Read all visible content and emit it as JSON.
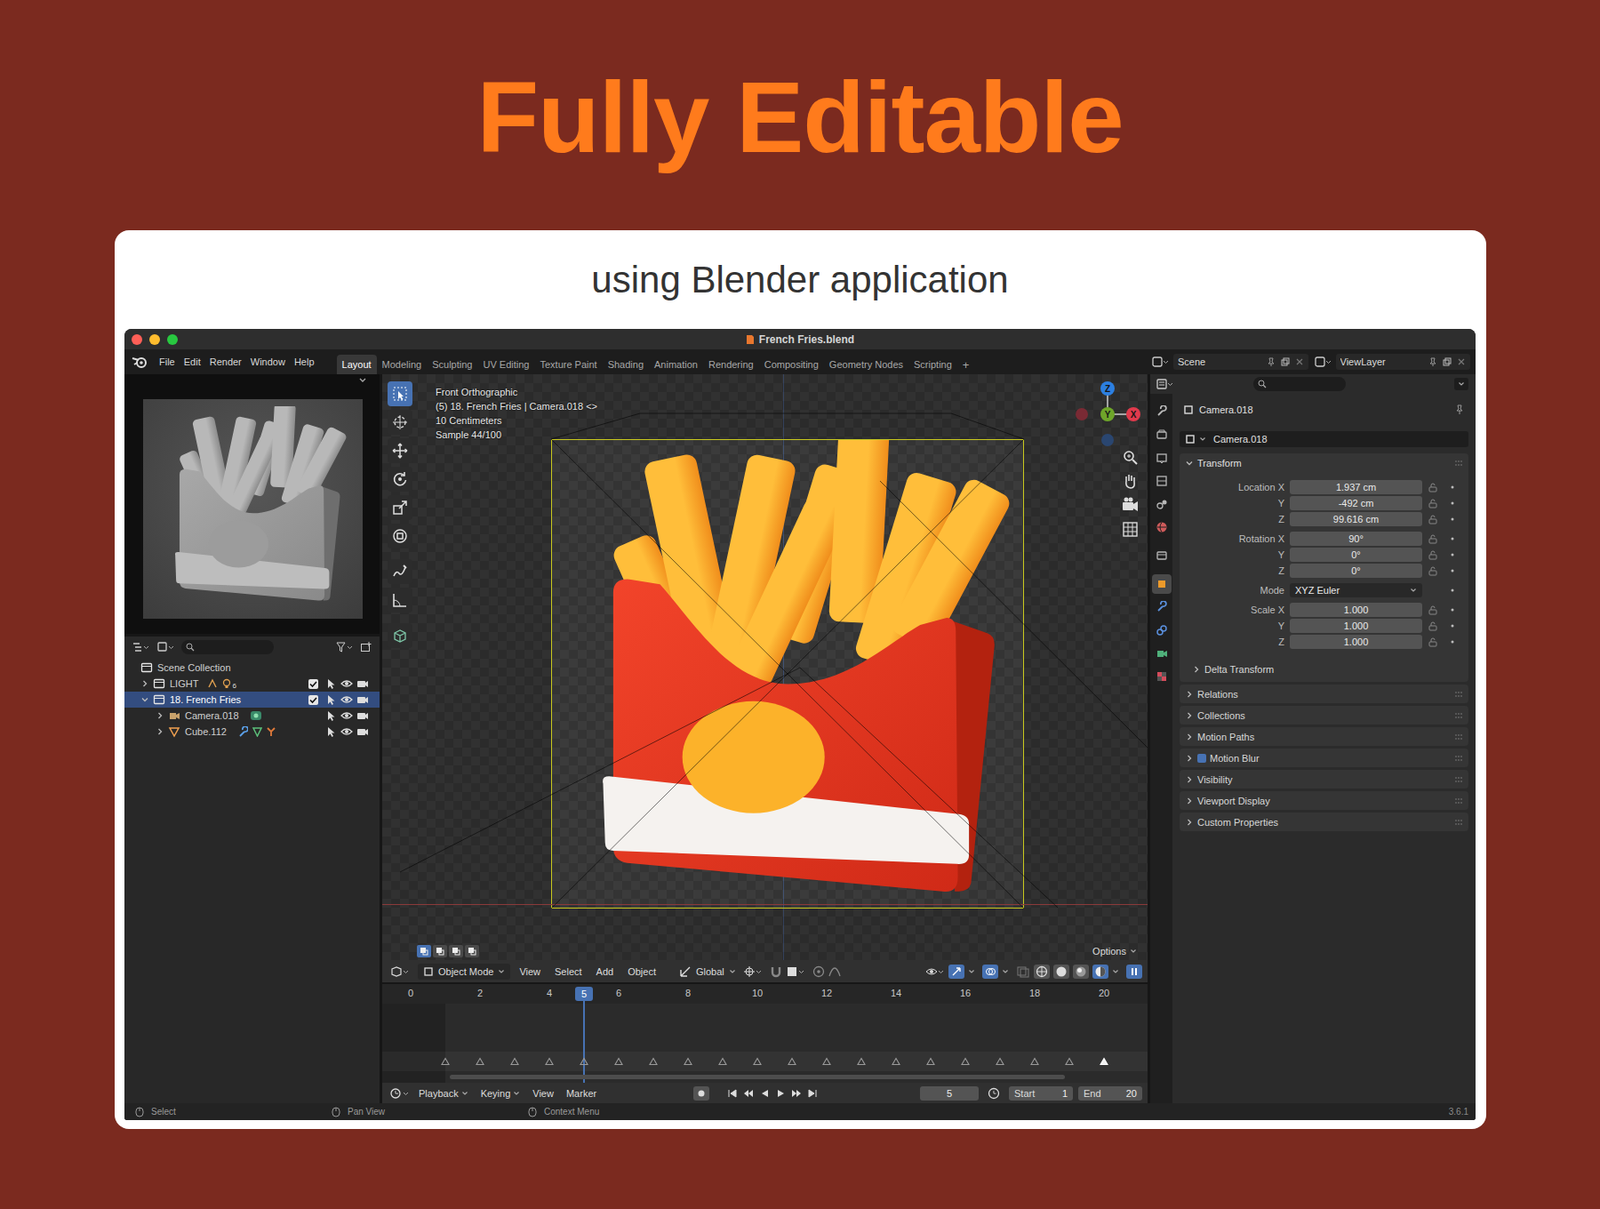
{
  "heading": "Fully Editable",
  "subtitle": "using Blender application",
  "window": {
    "title": "French Fries.blend"
  },
  "menu": [
    "File",
    "Edit",
    "Render",
    "Window",
    "Help"
  ],
  "workspaces": [
    {
      "label": "Layout",
      "selected": true
    },
    {
      "label": "Modeling",
      "selected": false
    },
    {
      "label": "Sculpting",
      "selected": false
    },
    {
      "label": "UV Editing",
      "selected": false
    },
    {
      "label": "Texture Paint",
      "selected": false
    },
    {
      "label": "Shading",
      "selected": false
    },
    {
      "label": "Animation",
      "selected": false
    },
    {
      "label": "Rendering",
      "selected": false
    },
    {
      "label": "Compositing",
      "selected": false
    },
    {
      "label": "Geometry Nodes",
      "selected": false
    },
    {
      "label": "Scripting",
      "selected": false
    }
  ],
  "add_workspace": "+",
  "scene": "Scene",
  "view_layer": "ViewLayer",
  "outliner": {
    "root": "Scene Collection",
    "items": [
      {
        "name": "LIGHT",
        "kind": "collection",
        "expanded": false,
        "selected": false,
        "checked": true,
        "badge": "6",
        "children": []
      },
      {
        "name": "18. French Fries",
        "kind": "collection",
        "expanded": true,
        "selected": true,
        "checked": true,
        "badge": "",
        "children": [
          {
            "name": "Camera.018",
            "kind": "camera",
            "expanded": false,
            "selected": false
          },
          {
            "name": "Cube.112",
            "kind": "mesh",
            "expanded": false,
            "selected": false
          }
        ]
      }
    ]
  },
  "viewport": {
    "overlay": [
      "Front Orthographic",
      "(5) 18. French Fries | Camera.018 <>",
      "10 Centimeters",
      "Sample 44/100"
    ],
    "tools": [
      {
        "selected": true
      },
      {
        "selected": false
      },
      {
        "selected": false
      },
      {
        "selected": false
      },
      {
        "selected": false
      },
      {
        "selected": false
      },
      {
        "selected": false
      },
      {
        "selected": false
      },
      {
        "selected": false
      }
    ],
    "select_modes": [
      {
        "selected": true
      },
      {
        "selected": false
      },
      {
        "selected": false
      },
      {
        "selected": false
      }
    ],
    "axes": [
      {
        "label": "Z",
        "color": "#2c7fe0"
      },
      {
        "label": "Y",
        "color": "#6ea52a"
      },
      {
        "label": "X",
        "color": "#e03a4c"
      }
    ],
    "mode": "Object Mode",
    "menus": [
      "View",
      "Select",
      "Add",
      "Object"
    ],
    "orientation": "Global",
    "options": "Options",
    "shading": [
      {
        "selected": false
      },
      {
        "selected": false
      },
      {
        "selected": false
      },
      {
        "selected": true
      }
    ]
  },
  "timeline": {
    "ticks": [
      "0",
      "2",
      "4",
      "6",
      "8",
      "10",
      "12",
      "14",
      "16",
      "18",
      "20"
    ],
    "current": "5",
    "keyframes": [
      {
        "frame": 1,
        "selected": false
      },
      {
        "frame": 2,
        "selected": false
      },
      {
        "frame": 3,
        "selected": false
      },
      {
        "frame": 4,
        "selected": false
      },
      {
        "frame": 5,
        "selected": false
      },
      {
        "frame": 6,
        "selected": false
      },
      {
        "frame": 7,
        "selected": false
      },
      {
        "frame": 8,
        "selected": false
      },
      {
        "frame": 9,
        "selected": false
      },
      {
        "frame": 10,
        "selected": false
      },
      {
        "frame": 11,
        "selected": false
      },
      {
        "frame": 12,
        "selected": false
      },
      {
        "frame": 13,
        "selected": false
      },
      {
        "frame": 14,
        "selected": false
      },
      {
        "frame": 15,
        "selected": false
      },
      {
        "frame": 16,
        "selected": false
      },
      {
        "frame": 17,
        "selected": false
      },
      {
        "frame": 18,
        "selected": false
      },
      {
        "frame": 19,
        "selected": false
      },
      {
        "frame": 20,
        "selected": true
      }
    ],
    "menus": [
      "Playback",
      "Keying",
      "View",
      "Marker"
    ],
    "frame": "5",
    "start_label": "Start",
    "start": "1",
    "end_label": "End",
    "end": "20"
  },
  "properties": {
    "tabs": [
      {
        "selected": false,
        "color": "#b8b8b8"
      },
      {
        "selected": false,
        "color": "#b8b8b8"
      },
      {
        "selected": false,
        "color": "#b8b8b8"
      },
      {
        "selected": false,
        "color": "#b8b8b8"
      },
      {
        "selected": false,
        "color": "#b8b8b8"
      },
      {
        "selected": false,
        "color": "#cf5b5b"
      },
      {
        "selected": false,
        "color": "#b8b8b8"
      },
      {
        "selected": true,
        "color": "#ec9a2a"
      },
      {
        "selected": false,
        "color": "#5a8fdc"
      },
      {
        "selected": false,
        "color": "#5a8fdc"
      },
      {
        "selected": false,
        "color": "#4fb07a"
      },
      {
        "selected": false,
        "color": "#d44b5b"
      }
    ],
    "object": "Camera.018",
    "datablock": "Camera.018",
    "transform": {
      "title": "Transform",
      "expanded": true,
      "groups": [
        {
          "rows": [
            {
              "label": "Location X",
              "value": "1.937 cm",
              "kind": "number"
            },
            {
              "label": "Y",
              "value": "-492 cm",
              "kind": "number"
            },
            {
              "label": "Z",
              "value": "99.616 cm",
              "kind": "number"
            }
          ]
        },
        {
          "rows": [
            {
              "label": "Rotation X",
              "value": "90°",
              "kind": "number"
            },
            {
              "label": "Y",
              "value": "0°",
              "kind": "number"
            },
            {
              "label": "Z",
              "value": "0°",
              "kind": "number"
            }
          ]
        },
        {
          "rows": [
            {
              "label": "Mode",
              "value": "XYZ Euler",
              "kind": "dropdown"
            }
          ]
        },
        {
          "rows": [
            {
              "label": "Scale X",
              "value": "1.000",
              "kind": "number"
            },
            {
              "label": "Y",
              "value": "1.000",
              "kind": "number"
            },
            {
              "label": "Z",
              "value": "1.000",
              "kind": "number"
            }
          ]
        }
      ]
    },
    "subpanel": {
      "title": "Delta Transform",
      "expanded": false
    },
    "panels": [
      {
        "title": "Relations",
        "kind": "plain",
        "expanded": false
      },
      {
        "title": "Collections",
        "kind": "plain",
        "expanded": false
      },
      {
        "title": "Motion Paths",
        "kind": "plain",
        "expanded": false
      },
      {
        "title": "Motion Blur",
        "kind": "checkbox",
        "checked": true,
        "expanded": false
      },
      {
        "title": "Visibility",
        "kind": "plain",
        "expanded": false
      },
      {
        "title": "Viewport Display",
        "kind": "plain",
        "expanded": false
      },
      {
        "title": "Custom Properties",
        "kind": "plain",
        "expanded": false
      }
    ]
  },
  "status_bar": {
    "items": [
      "Select",
      "Pan View",
      "Context Menu"
    ],
    "version": "3.6.1"
  }
}
